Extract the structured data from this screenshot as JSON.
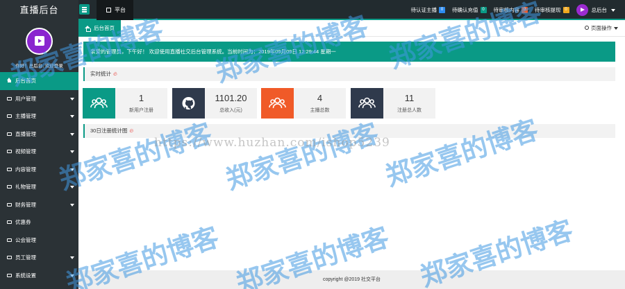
{
  "header": {
    "brand": "直播后台",
    "tab": "平台",
    "notices": [
      {
        "label": "待认证主播",
        "count": "0",
        "color": "#2d8cf0"
      },
      {
        "label": "待确认充值",
        "count": "0",
        "color": "#0a9a86"
      },
      {
        "label": "待审核内容",
        "count": "0",
        "color": "#f05a28"
      },
      {
        "label": "待审核提现",
        "count": "0",
        "color": "#f0a81e"
      }
    ],
    "user": "总后台"
  },
  "sidebar": {
    "greeting": "你好！总后台, 欢迎登录",
    "items": [
      {
        "label": "后台首页",
        "active": true,
        "icon": "home-icon"
      },
      {
        "label": "用户管理",
        "icon": "card-icon"
      },
      {
        "label": "主播管理",
        "icon": "card-icon"
      },
      {
        "label": "直播管理",
        "icon": "card-icon"
      },
      {
        "label": "视频管理",
        "icon": "card-icon"
      },
      {
        "label": "内容管理",
        "icon": "card-icon"
      },
      {
        "label": "礼物管理",
        "icon": "card-icon"
      },
      {
        "label": "财务管理",
        "icon": "card-icon"
      },
      {
        "label": "优惠券",
        "icon": "card-icon"
      },
      {
        "label": "公会管理",
        "icon": "card-icon"
      },
      {
        "label": "员工管理",
        "icon": "card-icon"
      },
      {
        "label": "系统设置",
        "icon": "card-icon"
      }
    ]
  },
  "main": {
    "tab_home": "后台首页",
    "page_ops": "页面操作",
    "welcome": "亲爱的管理员，下午好！ 欢迎使用直播社交后台管理系统。当前时间为：2019年09月09日 12:29:44   星期一",
    "realtime_title": "实时统计",
    "stats": [
      {
        "value": "1",
        "label": "新用户注册",
        "color": "#0a9a86",
        "icon": "users-icon"
      },
      {
        "value": "1101.20",
        "label": "总收入(元)",
        "color": "#2f3a4c",
        "icon": "github-icon"
      },
      {
        "value": "4",
        "label": "主播总数",
        "color": "#f05a28",
        "icon": "users-icon"
      },
      {
        "value": "11",
        "label": "注册总人数",
        "color": "#2f3a4c",
        "icon": "users-icon"
      }
    ],
    "chart_title": "30日注册统计图",
    "footer": "copyright @2019 社交平台"
  },
  "watermark": {
    "text": "郑家喜的博客",
    "url": "https://www.huzhan.com/ishop5239"
  }
}
